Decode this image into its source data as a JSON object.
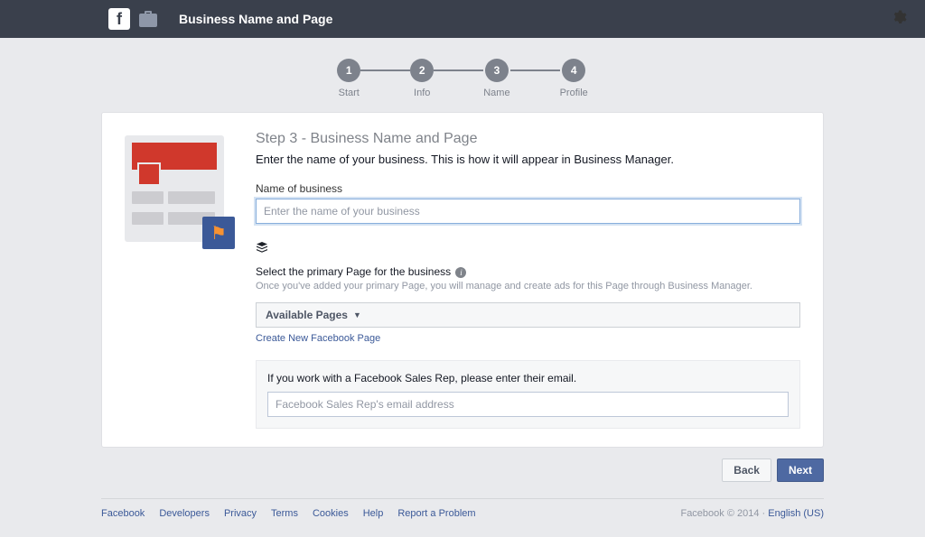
{
  "topbar": {
    "title": "Business Name and Page"
  },
  "stepper": {
    "steps": [
      {
        "num": "1",
        "label": "Start"
      },
      {
        "num": "2",
        "label": "Info"
      },
      {
        "num": "3",
        "label": "Name"
      },
      {
        "num": "4",
        "label": "Profile"
      }
    ]
  },
  "content": {
    "title": "Step 3 - Business Name and Page",
    "desc": "Enter the name of your business. This is how it will appear in Business Manager.",
    "name_label": "Name of business",
    "name_placeholder": "Enter the name of your business",
    "primary_label": "Select the primary Page for the business",
    "primary_help": "Once you've added your primary Page, you will manage and create ads for this Page through Business Manager.",
    "dropdown_label": "Available Pages",
    "create_link": "Create New Facebook Page",
    "rep_label": "If you work with a Facebook Sales Rep, please enter their email.",
    "rep_placeholder": "Facebook Sales Rep's email address"
  },
  "buttons": {
    "back": "Back",
    "next": "Next"
  },
  "footer": {
    "links": [
      "Facebook",
      "Developers",
      "Privacy",
      "Terms",
      "Cookies",
      "Help",
      "Report a Problem"
    ],
    "copyright": "Facebook © 2014 · ",
    "lang": "English (US)"
  }
}
